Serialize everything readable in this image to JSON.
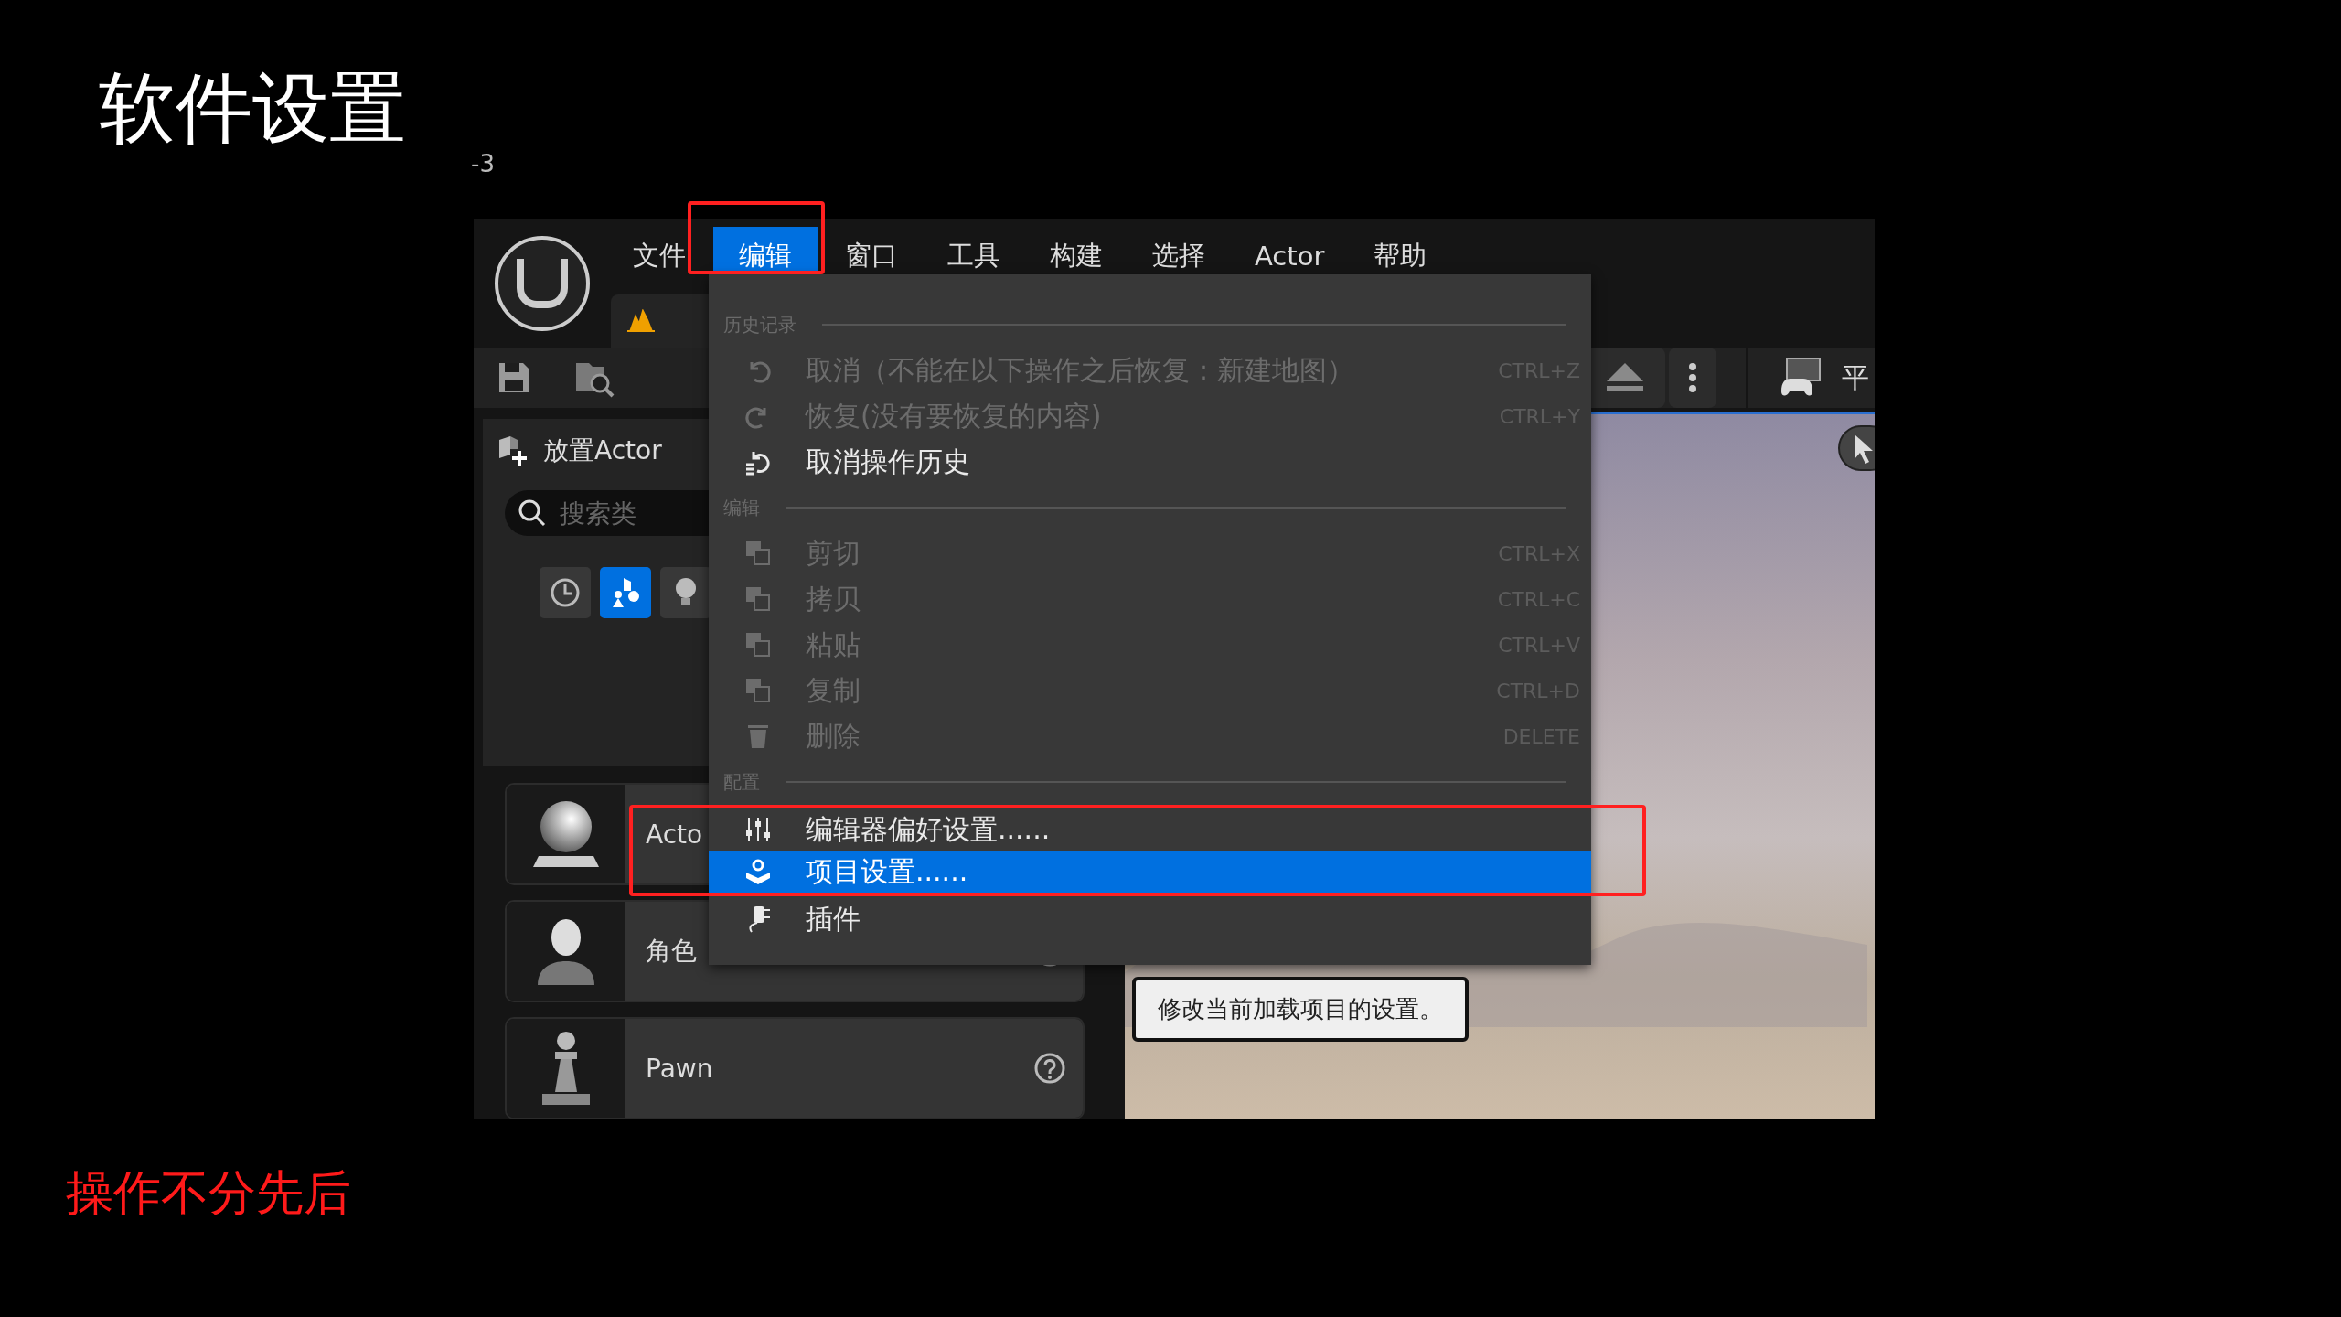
{
  "slide": {
    "title": "软件设置",
    "page_number": "-3",
    "caption": "操作不分先后"
  },
  "editor": {
    "menu_bar": [
      {
        "label": "文件",
        "selected": false
      },
      {
        "label": "编辑",
        "selected": true
      },
      {
        "label": "窗口",
        "selected": false
      },
      {
        "label": "工具",
        "selected": false
      },
      {
        "label": "构建",
        "selected": false
      },
      {
        "label": "选择",
        "selected": false
      },
      {
        "label": "Actor",
        "selected": false
      },
      {
        "label": "帮助",
        "selected": false
      }
    ],
    "toolbar": {
      "mode_label": "平"
    },
    "place_actors": {
      "title": "放置Actor",
      "search": {
        "placeholder": "搜索类"
      },
      "filters": [
        {
          "kind": "recent",
          "selected": false
        },
        {
          "kind": "basic",
          "selected": true
        },
        {
          "kind": "lights",
          "selected": false
        }
      ],
      "items": [
        {
          "kind": "actor",
          "label": "Acto"
        },
        {
          "kind": "character",
          "label": "角色"
        },
        {
          "kind": "pawn",
          "label": "Pawn"
        }
      ]
    },
    "dropdown": {
      "sections": [
        {
          "heading": "历史记录",
          "items": [
            {
              "kind": "undo",
              "label": "取消（不能在以下操作之后恢复：新建地图）",
              "shortcut": "CTRL+Z",
              "disabled": true,
              "selected": false
            },
            {
              "kind": "redo",
              "label": "恢复(没有要恢复的内容)",
              "shortcut": "CTRL+Y",
              "disabled": true,
              "selected": false
            },
            {
              "kind": "history",
              "label": "取消操作历史",
              "disabled": false,
              "selected": false
            }
          ]
        },
        {
          "heading": "编辑",
          "items": [
            {
              "kind": "cut",
              "label": "剪切",
              "shortcut": "CTRL+X",
              "disabled": true,
              "selected": false
            },
            {
              "kind": "copy",
              "label": "拷贝",
              "shortcut": "CTRL+C",
              "disabled": true,
              "selected": false
            },
            {
              "kind": "paste",
              "label": "粘贴",
              "shortcut": "CTRL+V",
              "disabled": true,
              "selected": false
            },
            {
              "kind": "duplicate",
              "label": "复制",
              "shortcut": "CTRL+D",
              "disabled": true,
              "selected": false
            },
            {
              "kind": "delete",
              "label": "删除",
              "shortcut": "DELETE",
              "disabled": true,
              "selected": false
            }
          ]
        },
        {
          "heading": "配置",
          "items": [
            {
              "kind": "preferences",
              "label": "编辑器偏好设置......",
              "disabled": false,
              "selected": false,
              "annotated": true
            },
            {
              "kind": "project",
              "label": "项目设置......",
              "disabled": false,
              "selected": true,
              "annotated": true
            },
            {
              "kind": "plugins",
              "label": "插件",
              "disabled": false,
              "selected": false,
              "annotated": false
            }
          ]
        }
      ]
    },
    "tooltip": "修改当前加载项目的设置。"
  }
}
